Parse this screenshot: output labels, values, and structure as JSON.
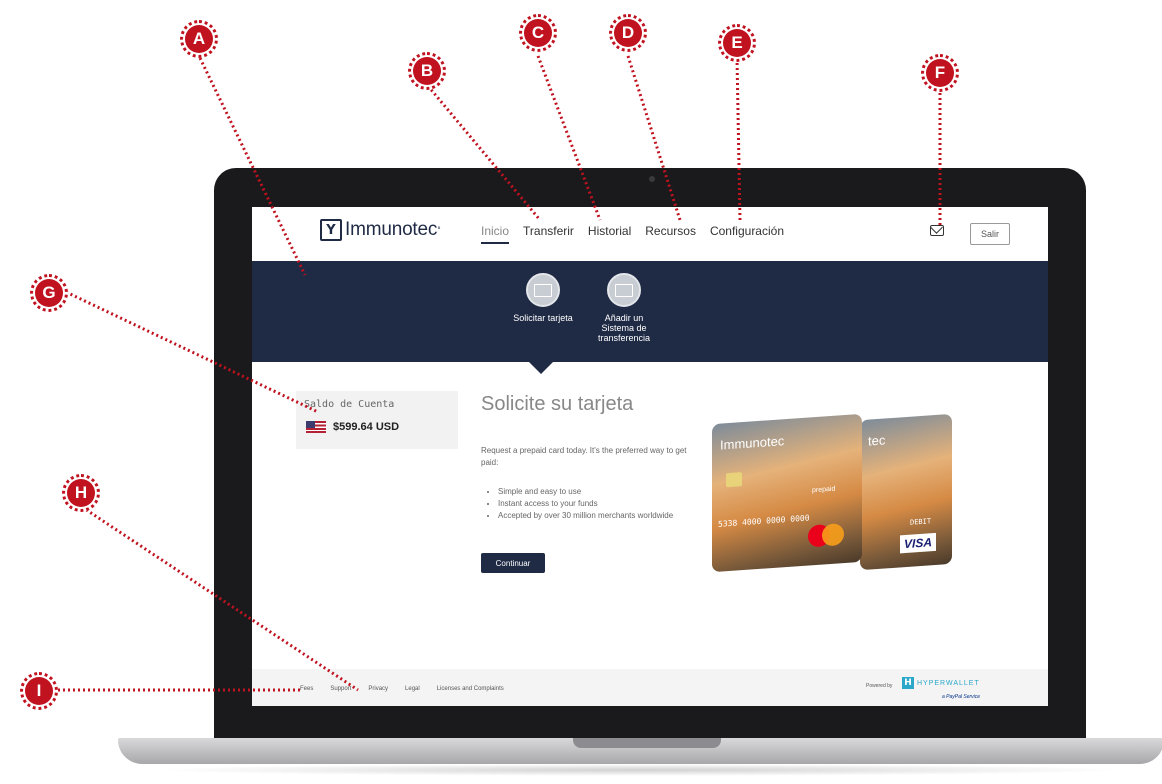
{
  "app": {
    "brand": "Immunotec",
    "nav": [
      "Inicio",
      "Transferir",
      "Historial",
      "Recursos",
      "Configuración"
    ],
    "logout": "Salir"
  },
  "band": {
    "options": [
      {
        "label": "Solicitar tarjeta",
        "icon": "card-request-icon"
      },
      {
        "label": "Añadir un Sistema de transferencia",
        "icon": "transfer-method-icon"
      }
    ]
  },
  "balance": {
    "title": "Saldo de Cuenta",
    "amount": "$599.64 USD",
    "flag": "us-flag-icon"
  },
  "main": {
    "heading": "Solicite su tarjeta",
    "intro": "Request a prepaid card today. It's the preferred way to get paid:",
    "bullets": [
      "Simple and easy to use",
      "Instant access to your funds",
      "Accepted by over 30 million merchants worldwide"
    ],
    "button": "Continuar"
  },
  "cards": {
    "front_brand": "Immunotec",
    "front_number": "5338 4000 0000 0000",
    "prepaid": "prepaid",
    "back_brand": "tec",
    "debit": "DEBIT",
    "visa": "VISA"
  },
  "footer": {
    "links": [
      "Fees",
      "Support",
      "Privacy",
      "Legal",
      "Licenses and Complaints"
    ],
    "powered": "Powered by",
    "hyperwallet": "HYPERWALLET",
    "paypal": "a PayPal Service"
  },
  "callouts": [
    "A",
    "B",
    "C",
    "D",
    "E",
    "F",
    "G",
    "H",
    "I"
  ],
  "colors": {
    "navy": "#1f2a44",
    "callout": "#c0121f"
  }
}
